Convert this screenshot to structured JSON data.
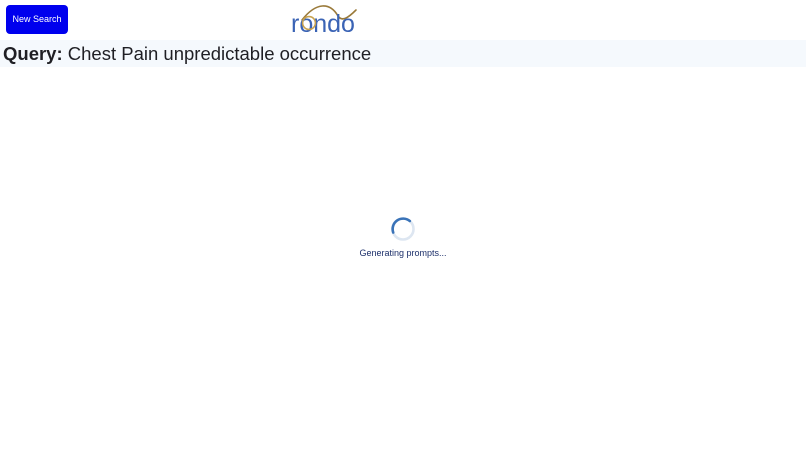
{
  "header": {
    "new_search_label": "New Search",
    "logo_text": "rondo",
    "logo_colors": {
      "text": "#3a63b5",
      "arc": "#9a7a3a",
      "ring": "#c8a24e"
    }
  },
  "query": {
    "label": "Query:",
    "text": "Chest Pain unpredictable occurrence"
  },
  "loading": {
    "status_text": "Generating prompts...",
    "spinner_color": "#3a73b8",
    "spinner_track_color": "#dde6f1"
  },
  "colors": {
    "button_bg": "#0000ee",
    "query_bar_bg": "#f5f9fd"
  }
}
